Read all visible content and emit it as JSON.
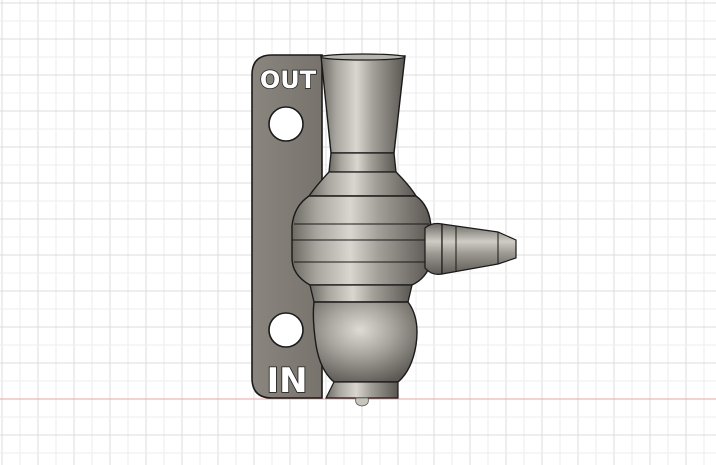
{
  "viewport": {
    "background": "#ffffff",
    "grid_color": "#dcdcdc",
    "grid_minor_color": "#eeeeee",
    "axis_x_color": "#e8a0a0",
    "axis_z_color": "#a8c8e8"
  },
  "model": {
    "name": "barbed-tee-fitting-with-mounting-plate",
    "plate_color": "#7f7b74",
    "body_color": "#8d8a84",
    "edge_color": "#1a1a1a",
    "labels": {
      "outlet_label": "OUT",
      "inlet_label": "IN"
    }
  }
}
